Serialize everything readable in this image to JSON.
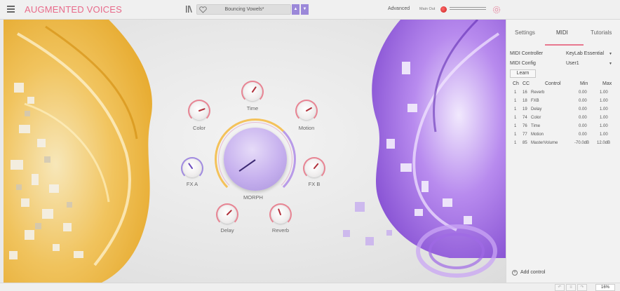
{
  "app": {
    "title": "AUGMENTED VOICES"
  },
  "header": {
    "preset_name": "Bouncing Vowels*",
    "prev_label": "▲",
    "next_label": "▼",
    "advanced_label": "Advanced",
    "main_out_label": "Main Out",
    "icons": [
      "menu-icon",
      "library-icon",
      "heart-icon",
      "gear-icon"
    ]
  },
  "knobs": {
    "time": {
      "label": "Time"
    },
    "color": {
      "label": "Color"
    },
    "motion": {
      "label": "Motion"
    },
    "fx_a": {
      "label": "FX A"
    },
    "fx_b": {
      "label": "FX B"
    },
    "morph": {
      "label": "MORPH"
    },
    "delay": {
      "label": "Delay"
    },
    "reverb": {
      "label": "Reverb"
    }
  },
  "panel": {
    "tabs": [
      "Settings",
      "MIDI",
      "Tutorials"
    ],
    "active_tab": "MIDI",
    "midi_controller_label": "MIDI Controller",
    "midi_controller_value": "KeyLab Essential",
    "midi_config_label": "MIDI Config",
    "midi_config_value": "User1",
    "learn_label": "Learn",
    "table_headers": [
      "Ch",
      "CC",
      "Control",
      "Min",
      "Max"
    ],
    "rows": [
      {
        "ch": "1",
        "cc": "16",
        "control": "Reverb",
        "min": "0.00",
        "max": "1.00"
      },
      {
        "ch": "1",
        "cc": "18",
        "control": "FXB",
        "min": "0.00",
        "max": "1.00"
      },
      {
        "ch": "1",
        "cc": "19",
        "control": "Delay",
        "min": "0.00",
        "max": "1.00"
      },
      {
        "ch": "1",
        "cc": "74",
        "control": "Color",
        "min": "0.00",
        "max": "1.00"
      },
      {
        "ch": "1",
        "cc": "76",
        "control": "Time",
        "min": "0.00",
        "max": "1.00"
      },
      {
        "ch": "1",
        "cc": "77",
        "control": "Motion",
        "min": "0.00",
        "max": "1.00"
      },
      {
        "ch": "1",
        "cc": "85",
        "control": "MasterVolume",
        "min": "-70.0dB",
        "max": "12.0dB"
      }
    ],
    "add_control_label": "Add control"
  },
  "footer": {
    "zoom_label": "16%"
  },
  "colors": {
    "accent_pink": "#e86a8a",
    "accent_purple": "#9b88d9",
    "gold": "#f4c25a"
  }
}
